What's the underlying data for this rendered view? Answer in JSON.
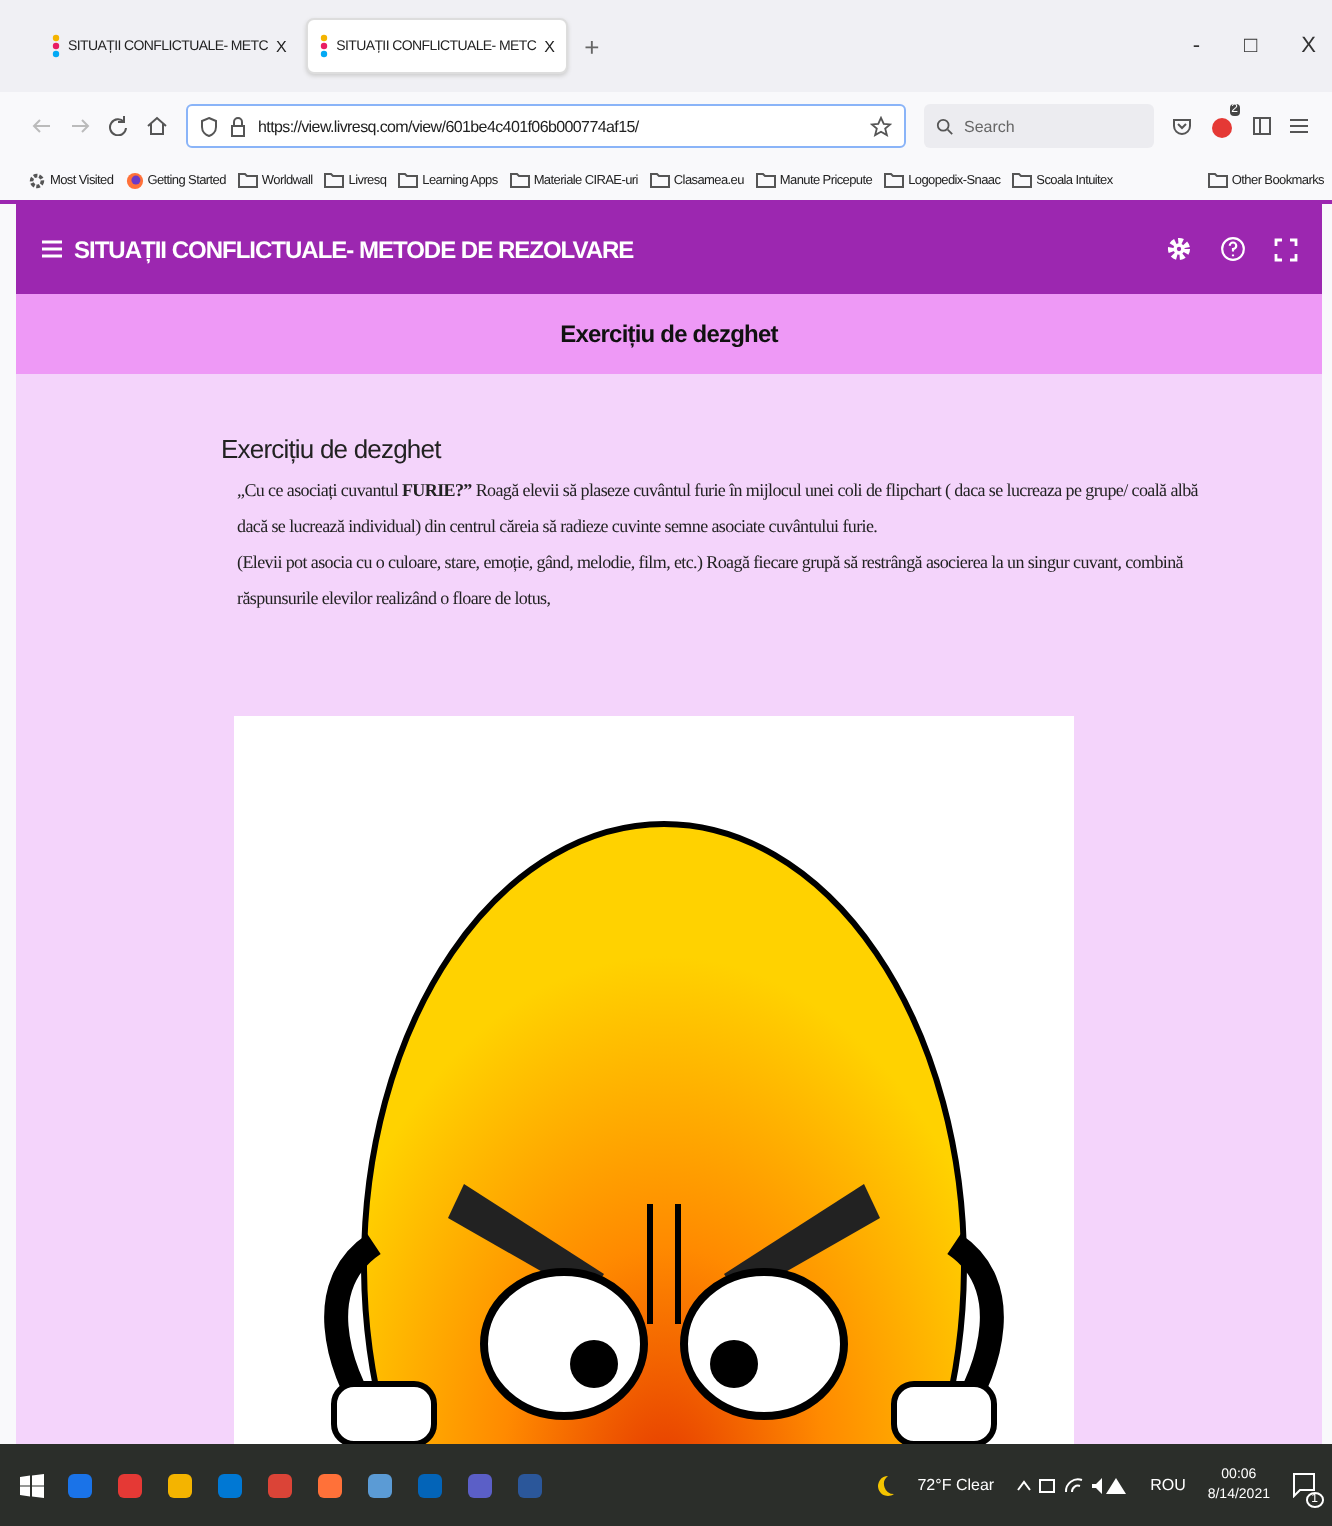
{
  "browser": {
    "tabs": [
      {
        "label": "SITUAȚII CONFLICTUALE- METC",
        "close": "X",
        "selected": false
      },
      {
        "label": "SITUAȚII CONFLICTUALE- METC",
        "close": "X",
        "selected": true
      }
    ],
    "new_tab": "+",
    "window_controls": [
      "-",
      "□",
      "X"
    ],
    "address": "https://view.livresq.com/view/601be4c401f06b000774af15/",
    "search": {
      "placeholder": "Search"
    },
    "extension_badge": "2",
    "bookmarks": [
      {
        "label": "Most Visited",
        "kind": "gear"
      },
      {
        "label": "Getting Started",
        "kind": "firefox"
      },
      {
        "label": "Worldwall",
        "kind": "folder"
      },
      {
        "label": "Livresq",
        "kind": "folder"
      },
      {
        "label": "Learning Apps",
        "kind": "folder"
      },
      {
        "label": "Materiale CIRAE-uri",
        "kind": "folder"
      },
      {
        "label": "Clasamea.eu",
        "kind": "folder"
      },
      {
        "label": "Manute Pricepute",
        "kind": "folder"
      },
      {
        "label": "Logopedix-Snaac",
        "kind": "folder"
      },
      {
        "label": "Scoala Intuitex",
        "kind": "folder"
      }
    ],
    "other_bookmarks": "Other Bookmarks"
  },
  "app": {
    "title": "SITUAȚII CONFLICTUALE- METODE DE REZOLVARE",
    "section_title": "Exercițiu de dezghet",
    "heading": "Exercițiu de dezghet",
    "paragraphs": [
      "„Cu ce asociați cuvantul **FURIE?”** Roagă elevii să plaseze cuvântul furie în mijlocul unei coli de flipchart ( daca se lucreaza pe grupe/ coală albă dacă se lucrează individual) din centrul căreia să radieze cuvinte semne asociate cuvântului furie.",
      "(Elevii pot asocia cu o culoare, stare, emoție, gând, melodie, film, etc.) Roagă fiecare grupă să restrângă asocierea la un singur cuvant, combină răspunsurile elevilor realizând o floare de lotus,"
    ]
  },
  "taskbar": {
    "weather": "72°F  Clear",
    "language": "ROU",
    "time": "00:06",
    "date": "8/14/2021",
    "notifications": "1"
  }
}
